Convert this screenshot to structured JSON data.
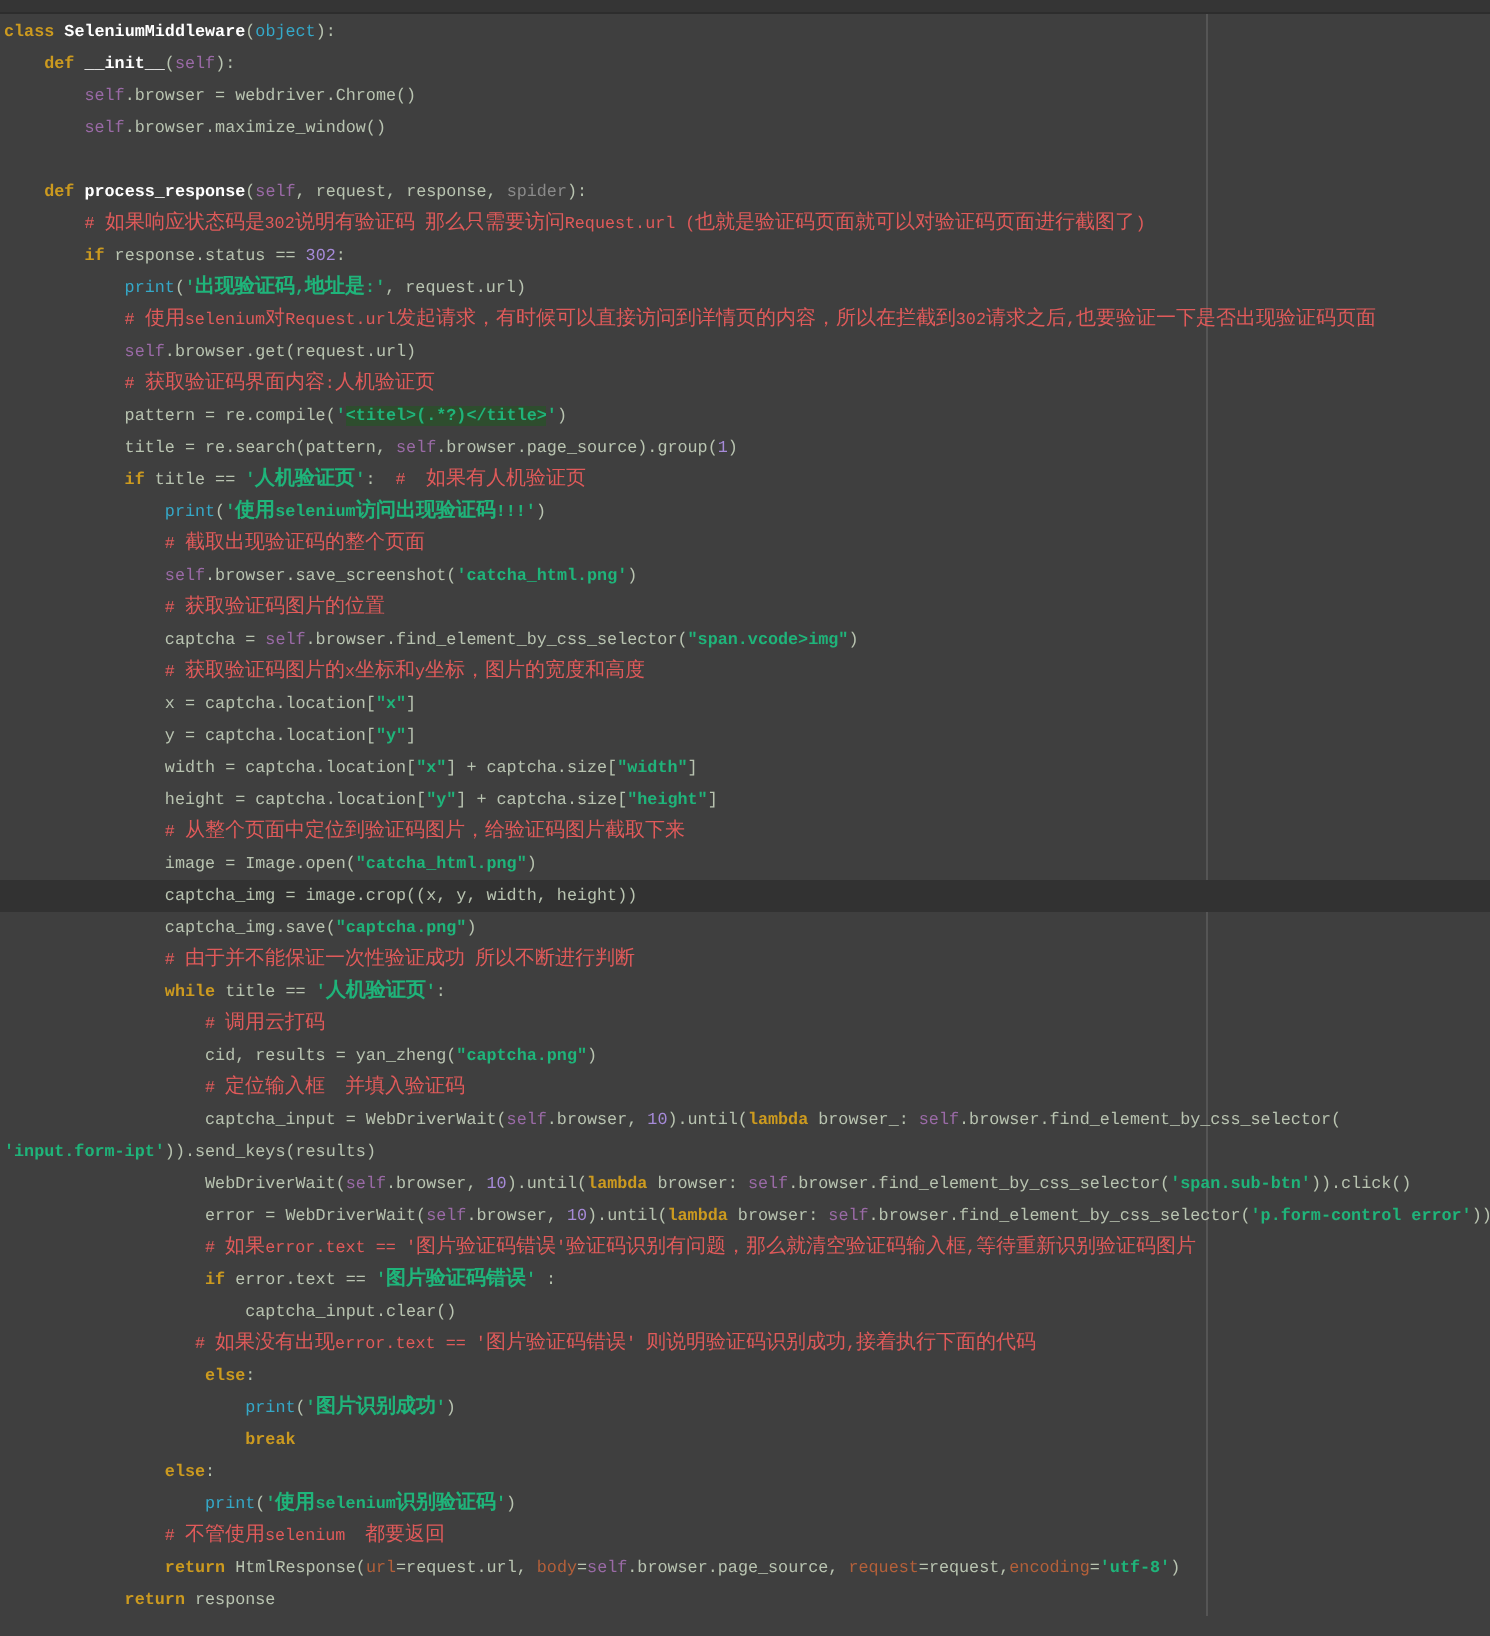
{
  "editor": {
    "lines": [
      {
        "kind": "code",
        "current": false,
        "tokens": [
          {
            "kind": "kw",
            "text": "class"
          },
          {
            "kind": "name",
            "text": " SeleniumMiddleware"
          },
          {
            "kind": "plain",
            "text": "("
          },
          {
            "kind": "builtin",
            "text": "object"
          },
          {
            "kind": "plain",
            "text": "):"
          }
        ]
      },
      {
        "kind": "code",
        "current": false,
        "tokens": [
          {
            "kind": "kw",
            "text": "    def"
          },
          {
            "kind": "name",
            "text": " __init__"
          },
          {
            "kind": "plain",
            "text": "("
          },
          {
            "kind": "self",
            "text": "self"
          },
          {
            "kind": "plain",
            "text": "):"
          }
        ]
      },
      {
        "kind": "code",
        "current": false,
        "tokens": [
          {
            "kind": "self",
            "text": "        self"
          },
          {
            "kind": "plain",
            "text": ".browser = webdriver.Chrome()"
          }
        ]
      },
      {
        "kind": "code",
        "current": false,
        "tokens": [
          {
            "kind": "self",
            "text": "        self"
          },
          {
            "kind": "plain",
            "text": ".browser.maximize_window()"
          }
        ]
      },
      {
        "kind": "blank",
        "current": false
      },
      {
        "kind": "code",
        "current": false,
        "tokens": [
          {
            "kind": "kw",
            "text": "    def"
          },
          {
            "kind": "name",
            "text": " process_response"
          },
          {
            "kind": "plain",
            "text": "("
          },
          {
            "kind": "self",
            "text": "self"
          },
          {
            "kind": "plain",
            "text": ", request, response, "
          },
          {
            "kind": "dim",
            "text": "spider"
          },
          {
            "kind": "plain",
            "text": "):"
          }
        ]
      },
      {
        "kind": "code",
        "current": false,
        "tokens": [
          {
            "kind": "comment",
            "text": "        # 如果响应状态码是302说明有验证码 那么只需要访问Request.url (也就是验证码页面就可以对验证码页面进行截图了)"
          }
        ]
      },
      {
        "kind": "code",
        "current": false,
        "tokens": [
          {
            "kind": "kw",
            "text": "        if"
          },
          {
            "kind": "plain",
            "text": " response.status == "
          },
          {
            "kind": "num",
            "text": "302"
          },
          {
            "kind": "plain",
            "text": ":"
          }
        ]
      },
      {
        "kind": "code",
        "current": false,
        "tokens": [
          {
            "kind": "builtin",
            "text": "            print"
          },
          {
            "kind": "plain",
            "text": "("
          },
          {
            "kind": "str",
            "text": "'出现验证码,地址是:'"
          },
          {
            "kind": "plain",
            "text": ", request.url)"
          }
        ]
      },
      {
        "kind": "code",
        "current": false,
        "tokens": [
          {
            "kind": "comment",
            "text": "            # 使用selenium对Request.url发起请求，有时候可以直接访问到详情页的内容，所以在拦截到302请求之后,也要验证一下是否出现验证码页面"
          }
        ]
      },
      {
        "kind": "code",
        "current": false,
        "tokens": [
          {
            "kind": "self",
            "text": "            self"
          },
          {
            "kind": "plain",
            "text": ".browser.get(request.url)"
          }
        ]
      },
      {
        "kind": "code",
        "current": false,
        "tokens": [
          {
            "kind": "comment",
            "text": "            # 获取验证码界面内容:人机验证页"
          }
        ]
      },
      {
        "kind": "code",
        "current": false,
        "tokens": [
          {
            "kind": "plain",
            "text": "            pattern = re.compile("
          },
          {
            "kind": "str",
            "text": "'"
          },
          {
            "kind": "regex",
            "text": "<titel>(.*?)</title>"
          },
          {
            "kind": "str",
            "text": "'"
          },
          {
            "kind": "plain",
            "text": ")"
          }
        ]
      },
      {
        "kind": "code",
        "current": false,
        "tokens": [
          {
            "kind": "plain",
            "text": "            title = re.search(pattern, "
          },
          {
            "kind": "self",
            "text": "self"
          },
          {
            "kind": "plain",
            "text": ".browser.page_source).group("
          },
          {
            "kind": "num",
            "text": "1"
          },
          {
            "kind": "plain",
            "text": ")"
          }
        ]
      },
      {
        "kind": "code",
        "current": false,
        "tokens": [
          {
            "kind": "kw",
            "text": "            if"
          },
          {
            "kind": "plain",
            "text": " title == "
          },
          {
            "kind": "str",
            "text": "'人机验证页'"
          },
          {
            "kind": "plain",
            "text": ":  "
          },
          {
            "kind": "comment",
            "text": "#  如果有人机验证页"
          }
        ]
      },
      {
        "kind": "code",
        "current": false,
        "tokens": [
          {
            "kind": "builtin",
            "text": "                print"
          },
          {
            "kind": "plain",
            "text": "("
          },
          {
            "kind": "str",
            "text": "'使用selenium访问出现验证码!!!'"
          },
          {
            "kind": "plain",
            "text": ")"
          }
        ]
      },
      {
        "kind": "code",
        "current": false,
        "tokens": [
          {
            "kind": "comment",
            "text": "                # 截取出现验证码的整个页面"
          }
        ]
      },
      {
        "kind": "code",
        "current": false,
        "tokens": [
          {
            "kind": "self",
            "text": "                self"
          },
          {
            "kind": "plain",
            "text": ".browser.save_screenshot("
          },
          {
            "kind": "str",
            "text": "'catcha_html.png'"
          },
          {
            "kind": "plain",
            "text": ")"
          }
        ]
      },
      {
        "kind": "code",
        "current": false,
        "tokens": [
          {
            "kind": "comment",
            "text": "                # 获取验证码图片的位置"
          }
        ]
      },
      {
        "kind": "code",
        "current": false,
        "tokens": [
          {
            "kind": "plain",
            "text": "                captcha = "
          },
          {
            "kind": "self",
            "text": "self"
          },
          {
            "kind": "plain",
            "text": ".browser.find_element_by_css_selector("
          },
          {
            "kind": "str",
            "text": "\"span.vcode>img\""
          },
          {
            "kind": "plain",
            "text": ")"
          }
        ]
      },
      {
        "kind": "code",
        "current": false,
        "tokens": [
          {
            "kind": "comment",
            "text": "                # 获取验证码图片的x坐标和y坐标，图片的宽度和高度"
          }
        ]
      },
      {
        "kind": "code",
        "current": false,
        "tokens": [
          {
            "kind": "plain",
            "text": "                x = captcha.location["
          },
          {
            "kind": "str",
            "text": "\"x\""
          },
          {
            "kind": "plain",
            "text": "]"
          }
        ]
      },
      {
        "kind": "code",
        "current": false,
        "tokens": [
          {
            "kind": "plain",
            "text": "                y = captcha.location["
          },
          {
            "kind": "str",
            "text": "\"y\""
          },
          {
            "kind": "plain",
            "text": "]"
          }
        ]
      },
      {
        "kind": "code",
        "current": false,
        "tokens": [
          {
            "kind": "plain",
            "text": "                width = captcha.location["
          },
          {
            "kind": "str",
            "text": "\"x\""
          },
          {
            "kind": "plain",
            "text": "] + captcha.size["
          },
          {
            "kind": "str",
            "text": "\"width\""
          },
          {
            "kind": "plain",
            "text": "]"
          }
        ]
      },
      {
        "kind": "code",
        "current": false,
        "tokens": [
          {
            "kind": "plain",
            "text": "                height = captcha.location["
          },
          {
            "kind": "str",
            "text": "\"y\""
          },
          {
            "kind": "plain",
            "text": "] + captcha.size["
          },
          {
            "kind": "str",
            "text": "\"height\""
          },
          {
            "kind": "plain",
            "text": "]"
          }
        ]
      },
      {
        "kind": "code",
        "current": false,
        "tokens": [
          {
            "kind": "comment",
            "text": "                # 从整个页面中定位到验证码图片，给验证码图片截取下来"
          }
        ]
      },
      {
        "kind": "code",
        "current": false,
        "tokens": [
          {
            "kind": "plain",
            "text": "                image = Image.open("
          },
          {
            "kind": "str",
            "text": "\"catcha_html.png\""
          },
          {
            "kind": "plain",
            "text": ")"
          }
        ]
      },
      {
        "kind": "code",
        "current": true,
        "tokens": [
          {
            "kind": "plain",
            "text": "                captcha_img = image.crop((x, y, width, height))"
          }
        ]
      },
      {
        "kind": "code",
        "current": false,
        "tokens": [
          {
            "kind": "plain",
            "text": "                captcha_img.save("
          },
          {
            "kind": "str",
            "text": "\"captcha.png\""
          },
          {
            "kind": "plain",
            "text": ")"
          }
        ]
      },
      {
        "kind": "code",
        "current": false,
        "tokens": [
          {
            "kind": "comment",
            "text": "                # 由于并不能保证一次性验证成功 所以不断进行判断"
          }
        ]
      },
      {
        "kind": "code",
        "current": false,
        "tokens": [
          {
            "kind": "kw",
            "text": "                while"
          },
          {
            "kind": "plain",
            "text": " title == "
          },
          {
            "kind": "str",
            "text": "'人机验证页'"
          },
          {
            "kind": "plain",
            "text": ":"
          }
        ]
      },
      {
        "kind": "code",
        "current": false,
        "tokens": [
          {
            "kind": "comment",
            "text": "                    # 调用云打码"
          }
        ]
      },
      {
        "kind": "code",
        "current": false,
        "tokens": [
          {
            "kind": "plain",
            "text": "                    cid, results = yan_zheng("
          },
          {
            "kind": "str",
            "text": "\"captcha.png\""
          },
          {
            "kind": "plain",
            "text": ")"
          }
        ]
      },
      {
        "kind": "code",
        "current": false,
        "tokens": [
          {
            "kind": "comment",
            "text": "                    # 定位输入框  并填入验证码"
          }
        ]
      },
      {
        "kind": "code",
        "current": false,
        "tokens": [
          {
            "kind": "plain",
            "text": "                    captcha_input = WebDriverWait("
          },
          {
            "kind": "self",
            "text": "self"
          },
          {
            "kind": "plain",
            "text": ".browser, "
          },
          {
            "kind": "num",
            "text": "10"
          },
          {
            "kind": "plain",
            "text": ").until("
          },
          {
            "kind": "kw",
            "text": "lambda"
          },
          {
            "kind": "plain",
            "text": " browser_: "
          },
          {
            "kind": "self",
            "text": "self"
          },
          {
            "kind": "plain",
            "text": ".browser.find_element_by_css_selector("
          }
        ]
      },
      {
        "kind": "code",
        "current": false,
        "tokens": [
          {
            "kind": "str",
            "text": "'input.form-ipt'"
          },
          {
            "kind": "plain",
            "text": ")).send_keys(results)"
          }
        ]
      },
      {
        "kind": "code",
        "current": false,
        "tokens": [
          {
            "kind": "plain",
            "text": "                    WebDriverWait("
          },
          {
            "kind": "self",
            "text": "self"
          },
          {
            "kind": "plain",
            "text": ".browser, "
          },
          {
            "kind": "num",
            "text": "10"
          },
          {
            "kind": "plain",
            "text": ").until("
          },
          {
            "kind": "kw",
            "text": "lambda"
          },
          {
            "kind": "plain",
            "text": " browser: "
          },
          {
            "kind": "self",
            "text": "self"
          },
          {
            "kind": "plain",
            "text": ".browser.find_element_by_css_selector("
          },
          {
            "kind": "str",
            "text": "'span.sub-btn'"
          },
          {
            "kind": "plain",
            "text": ")).click()"
          }
        ]
      },
      {
        "kind": "code",
        "current": false,
        "tokens": [
          {
            "kind": "plain",
            "text": "                    error = WebDriverWait("
          },
          {
            "kind": "self",
            "text": "self"
          },
          {
            "kind": "plain",
            "text": ".browser, "
          },
          {
            "kind": "num",
            "text": "10"
          },
          {
            "kind": "plain",
            "text": ").until("
          },
          {
            "kind": "kw",
            "text": "lambda"
          },
          {
            "kind": "plain",
            "text": " browser: "
          },
          {
            "kind": "self",
            "text": "self"
          },
          {
            "kind": "plain",
            "text": ".browser.find_element_by_css_selector("
          },
          {
            "kind": "str",
            "text": "'p.form-control error'"
          },
          {
            "kind": "plain",
            "text": "))"
          }
        ]
      },
      {
        "kind": "code",
        "current": false,
        "tokens": [
          {
            "kind": "comment",
            "text": "                    # 如果error.text == '图片验证码错误'验证码识别有问题，那么就清空验证码输入框,等待重新识别验证码图片"
          }
        ]
      },
      {
        "kind": "code",
        "current": false,
        "tokens": [
          {
            "kind": "kw",
            "text": "                    if"
          },
          {
            "kind": "plain",
            "text": " error.text == "
          },
          {
            "kind": "str",
            "text": "'图片验证码错误'"
          },
          {
            "kind": "plain",
            "text": " :"
          }
        ]
      },
      {
        "kind": "code",
        "current": false,
        "tokens": [
          {
            "kind": "plain",
            "text": "                        captcha_input.clear()"
          }
        ]
      },
      {
        "kind": "code",
        "current": false,
        "tokens": [
          {
            "kind": "comment",
            "text": "                   # 如果没有出现error.text == '图片验证码错误' 则说明验证码识别成功,接着执行下面的代码"
          }
        ]
      },
      {
        "kind": "code",
        "current": false,
        "tokens": [
          {
            "kind": "kw",
            "text": "                    else"
          },
          {
            "kind": "plain",
            "text": ":"
          }
        ]
      },
      {
        "kind": "code",
        "current": false,
        "tokens": [
          {
            "kind": "builtin",
            "text": "                        print"
          },
          {
            "kind": "plain",
            "text": "("
          },
          {
            "kind": "str",
            "text": "'图片识别成功'"
          },
          {
            "kind": "plain",
            "text": ")"
          }
        ]
      },
      {
        "kind": "code",
        "current": false,
        "tokens": [
          {
            "kind": "kw",
            "text": "                        break"
          }
        ]
      },
      {
        "kind": "code",
        "current": false,
        "tokens": [
          {
            "kind": "kw",
            "text": "                else"
          },
          {
            "kind": "plain",
            "text": ":"
          }
        ]
      },
      {
        "kind": "code",
        "current": false,
        "tokens": [
          {
            "kind": "builtin",
            "text": "                    print"
          },
          {
            "kind": "plain",
            "text": "("
          },
          {
            "kind": "str",
            "text": "'使用selenium识别验证码'"
          },
          {
            "kind": "plain",
            "text": ")"
          }
        ]
      },
      {
        "kind": "code",
        "current": false,
        "tokens": [
          {
            "kind": "comment",
            "text": "                # 不管使用selenium  都要返回"
          }
        ]
      },
      {
        "kind": "code",
        "current": false,
        "tokens": [
          {
            "kind": "kw",
            "text": "                return"
          },
          {
            "kind": "plain",
            "text": " HtmlResponse("
          },
          {
            "kind": "param",
            "text": "url"
          },
          {
            "kind": "plain",
            "text": "=request.url, "
          },
          {
            "kind": "param",
            "text": "body"
          },
          {
            "kind": "plain",
            "text": "="
          },
          {
            "kind": "self",
            "text": "self"
          },
          {
            "kind": "plain",
            "text": ".browser.page_source, "
          },
          {
            "kind": "param",
            "text": "request"
          },
          {
            "kind": "plain",
            "text": "=request,"
          },
          {
            "kind": "param",
            "text": "encoding"
          },
          {
            "kind": "plain",
            "text": "="
          },
          {
            "kind": "str",
            "text": "'utf-8'"
          },
          {
            "kind": "plain",
            "text": ")"
          }
        ]
      },
      {
        "kind": "code",
        "current": false,
        "tokens": [
          {
            "kind": "kw",
            "text": "            return"
          },
          {
            "kind": "plain",
            "text": " response"
          }
        ]
      }
    ]
  }
}
